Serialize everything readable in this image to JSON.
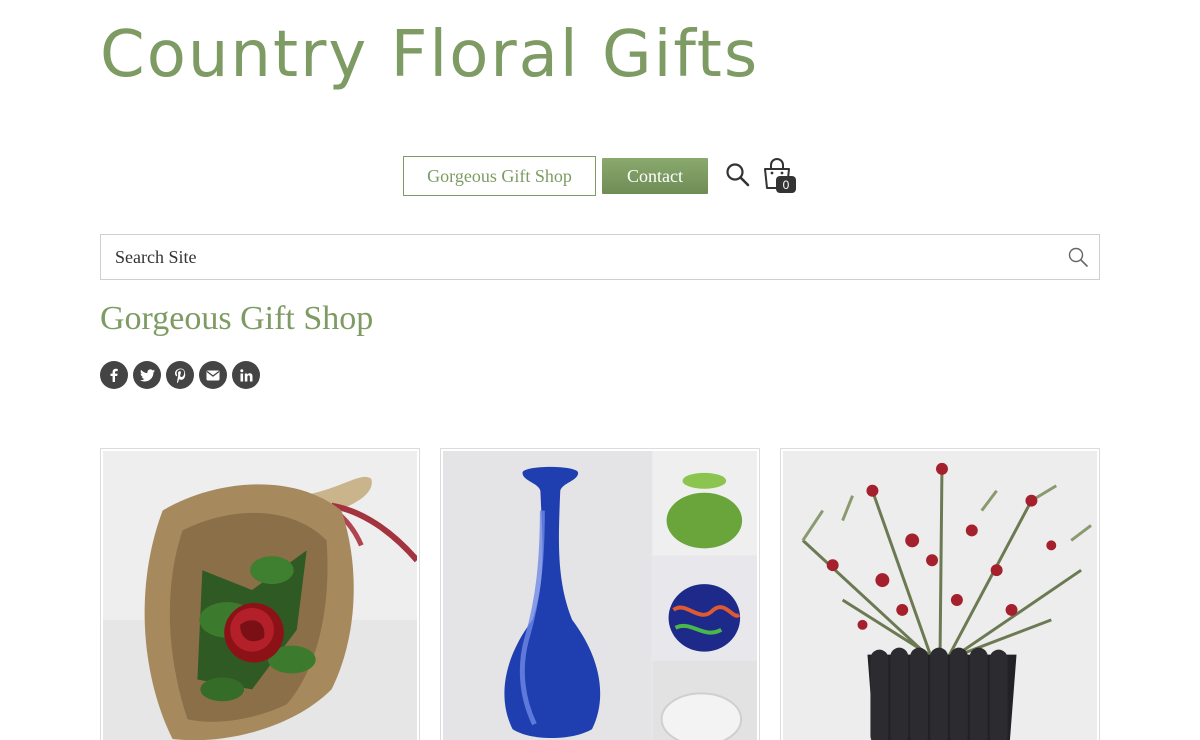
{
  "site": {
    "title": "Country Floral Gifts"
  },
  "nav": {
    "items": [
      {
        "label": "Gorgeous Gift Shop"
      },
      {
        "label": "Contact"
      }
    ],
    "cart_count": "0"
  },
  "search": {
    "placeholder": "Search Site"
  },
  "page": {
    "heading": "Gorgeous Gift Shop"
  },
  "share": {
    "icons": [
      "facebook-icon",
      "twitter-icon",
      "pinterest-icon",
      "email-icon",
      "linkedin-icon"
    ]
  },
  "products": [
    {
      "image": "red rose bouquet in brown paper wrap"
    },
    {
      "image": "blue glass vase with green, multicolor and clear glass bowls"
    },
    {
      "image": "red flower arrangement in black pot"
    }
  ],
  "colors": {
    "brand_green": "#7d9b63",
    "icon_dark": "#444444"
  }
}
